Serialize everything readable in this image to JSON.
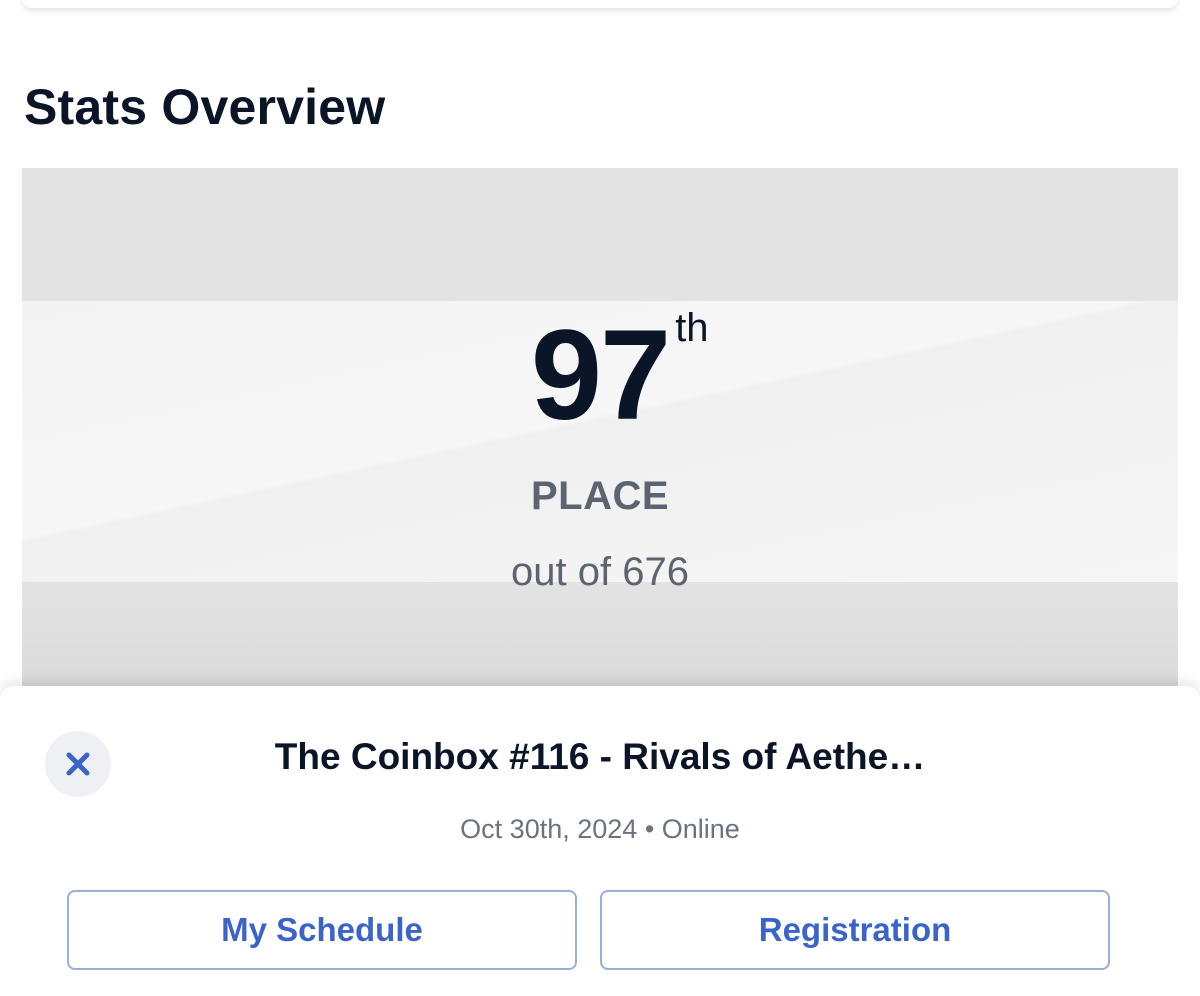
{
  "section": {
    "title": "Stats Overview"
  },
  "stats": {
    "rank": "97",
    "rank_suffix": "th",
    "rank_label": "PLACE",
    "total_text": "out of 676"
  },
  "event": {
    "title": "The Coinbox #116 - Rivals of Aethe…",
    "date": "Oct 30th, 2024",
    "separator": "•",
    "location": "Online"
  },
  "actions": {
    "schedule_label": "My Schedule",
    "registration_label": "Registration"
  },
  "icons": {
    "close": "close-icon"
  },
  "colors": {
    "heading": "#0b1528",
    "muted_text": "#5b6470",
    "accent": "#3b64c8",
    "button_border": "#9aaedc",
    "close_bg": "#eef0f4"
  }
}
